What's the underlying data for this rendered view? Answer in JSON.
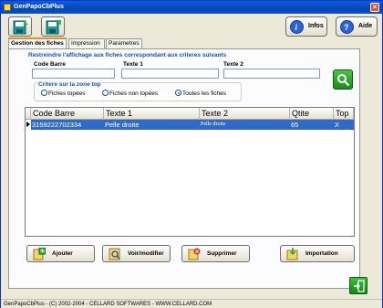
{
  "window": {
    "title": "GenPapoCbPlus",
    "close_glyph": "×"
  },
  "toolbar": {
    "left_buttons": [
      "save-add-icon",
      "save-icon"
    ],
    "info_label": "Infos",
    "help_label": "Aide"
  },
  "tabs": [
    {
      "label": "Gestion des fiches",
      "active": true
    },
    {
      "label": "Impression",
      "active": false
    },
    {
      "label": "Parametres",
      "active": false
    }
  ],
  "filter": {
    "title": "Restreindre l'affichage aux fiches correspondant aux criteres suivants",
    "fields": [
      {
        "label": "Code Barre",
        "value": ""
      },
      {
        "label": "Texte 1",
        "value": ""
      },
      {
        "label": "Texte 2",
        "value": ""
      }
    ],
    "zone_top_label": "Critere sur la zone top",
    "zone_options": [
      {
        "label": "Fiches topées",
        "checked": false
      },
      {
        "label": "Fiches non topées",
        "checked": false
      },
      {
        "label": "Toutes les fiches",
        "checked": true
      }
    ],
    "search_icon": "search-icon"
  },
  "grid": {
    "columns": [
      "Code Barre",
      "Texte 1",
      "Texte 2",
      "Qtite",
      "Top"
    ],
    "rows": [
      {
        "code_barre": "3159222702334",
        "texte1": "Pelle droite",
        "texte2": "Pelle droite",
        "qtite": "65",
        "top": "X"
      }
    ]
  },
  "actions": {
    "add_label": "Ajouter",
    "view_label": "Voir/modifier",
    "delete_label": "Supprimer",
    "import_label": "Importation"
  },
  "status": {
    "text": "GenPapoCbPlus - (C) 2002-2004 - CELLARD SOFTWARES - WWW.CELLARD.COM"
  },
  "colors": {
    "titlebar": "#0a53c9",
    "selection": "#316ac5",
    "accent_green": "#1c8a1c",
    "label_blue": "#1b4fb7"
  }
}
